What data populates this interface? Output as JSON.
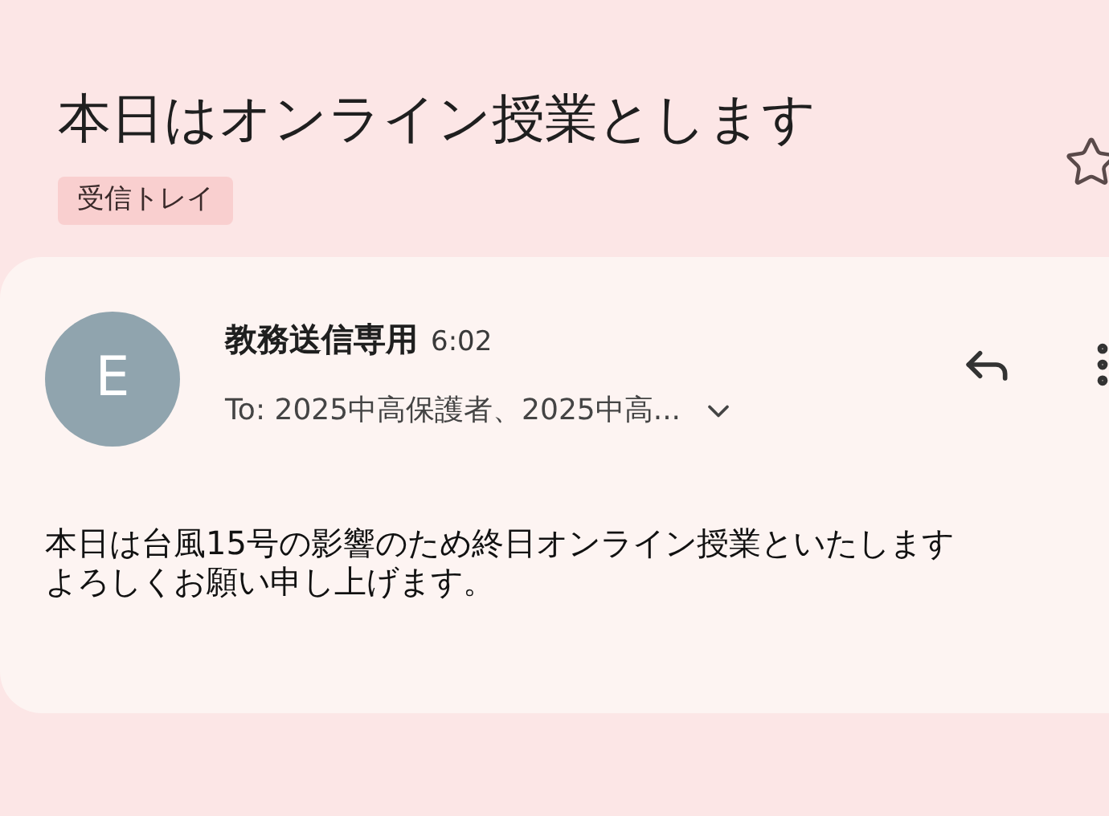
{
  "subject": "本日はオンライン授業とします",
  "label": "受信トレイ",
  "starred": false,
  "message": {
    "avatar_letter": "E",
    "sender": "教務送信専用",
    "time": "6:02",
    "to": "To: 2025中高保護者、2025中高...",
    "body": [
      "本日は台風15号の影響のため終日オンライン授業といたします",
      "よろしくお願い申し上げます。"
    ]
  }
}
